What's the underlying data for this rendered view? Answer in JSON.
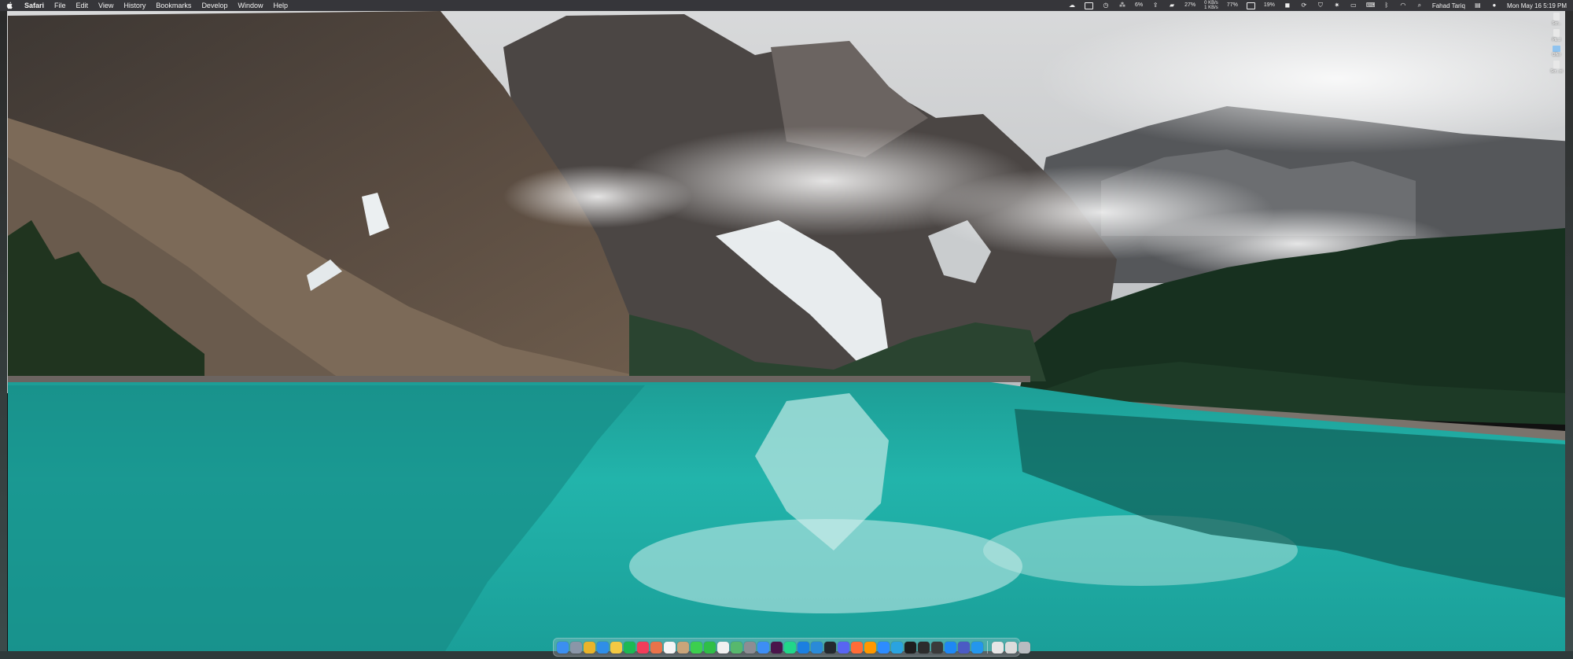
{
  "menubar": {
    "app_name": "Safari",
    "menus": [
      "File",
      "Edit",
      "View",
      "History",
      "Bookmarks",
      "Develop",
      "Window",
      "Help"
    ],
    "stats": [
      {
        "top": "6%",
        "bottom": ""
      },
      {
        "top": "27%",
        "bottom": ""
      },
      {
        "top": "0 KB/s",
        "bottom": "1 KB/s"
      },
      {
        "top": "77%",
        "bottom": ""
      },
      {
        "top": "19%",
        "bottom": ""
      }
    ],
    "user_name": "Fahad Tariq",
    "datetime": "Mon May 16  5:19 PM"
  },
  "desktop_icons": [
    {
      "icon": "document-icon",
      "label": "Scr..."
    },
    {
      "icon": "document-icon",
      "label": "Pli...l"
    },
    {
      "icon": "folder-icon",
      "label": "Offer"
    },
    {
      "icon": "document-icon",
      "label": "Scr...ot"
    }
  ],
  "dock": {
    "apps": [
      {
        "name": "finder-icon",
        "color": "#3b8ff0"
      },
      {
        "name": "launchpad-icon",
        "color": "#8a96a8"
      },
      {
        "name": "chrome-icon",
        "color": "#e9b42a"
      },
      {
        "name": "safari-icon",
        "color": "#2f8ee8"
      },
      {
        "name": "notes-icon",
        "color": "#f3c943"
      },
      {
        "name": "spotify-icon",
        "color": "#1db954"
      },
      {
        "name": "music-icon",
        "color": "#f23d5a"
      },
      {
        "name": "photos-icon",
        "color": "#e9734a"
      },
      {
        "name": "calendar-icon",
        "color": "#f5f5f5"
      },
      {
        "name": "contacts-icon",
        "color": "#c9a57a"
      },
      {
        "name": "messages-icon",
        "color": "#3ccf4e"
      },
      {
        "name": "facetime-icon",
        "color": "#2fbf47"
      },
      {
        "name": "reminders-icon",
        "color": "#f0f0f0"
      },
      {
        "name": "maps-icon",
        "color": "#57b86d"
      },
      {
        "name": "settings-icon",
        "color": "#8d8d93"
      },
      {
        "name": "mail-icon",
        "color": "#3d8ef5"
      },
      {
        "name": "slack-icon",
        "color": "#4a154b"
      },
      {
        "name": "pycharm-icon",
        "color": "#21d789"
      },
      {
        "name": "xcode-icon",
        "color": "#1b7fe0"
      },
      {
        "name": "vscode-icon",
        "color": "#2a8ad8"
      },
      {
        "name": "github-icon",
        "color": "#24292e"
      },
      {
        "name": "discord-icon",
        "color": "#5865f2"
      },
      {
        "name": "postman-icon",
        "color": "#ff6c37"
      },
      {
        "name": "sublime-icon",
        "color": "#ff9800"
      },
      {
        "name": "zoom-icon",
        "color": "#2d8cff"
      },
      {
        "name": "telegram-icon",
        "color": "#2aa3e0"
      },
      {
        "name": "terminal-icon",
        "color": "#1e1e1e"
      },
      {
        "name": "iterm-icon",
        "color": "#2c2c2c"
      },
      {
        "name": "activity-icon",
        "color": "#3a3a3a"
      },
      {
        "name": "appstore-icon",
        "color": "#1e88f5"
      },
      {
        "name": "teams-icon",
        "color": "#4b5bc4"
      },
      {
        "name": "docker-icon",
        "color": "#2496ed"
      }
    ],
    "right_items": [
      {
        "name": "downloads-stack-icon",
        "color": "#e6e6e6"
      },
      {
        "name": "documents-stack-icon",
        "color": "#dcdcdc"
      },
      {
        "name": "trash-icon",
        "color": "#b8bcc0"
      }
    ]
  },
  "colors": {
    "menubar_bg": "#28282c",
    "lake": "#24b6ad"
  }
}
